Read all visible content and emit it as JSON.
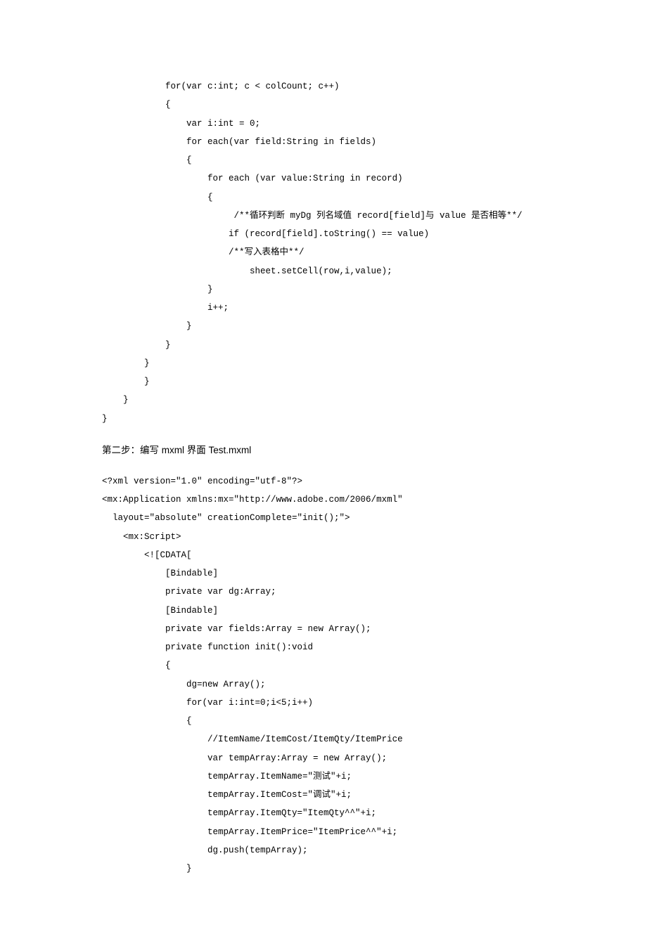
{
  "code1": "            for(var c:int; c < colCount; c++)\n            {\n                var i:int = 0;\n                for each(var field:String in fields)\n                {\n                    for each (var value:String in record)\n                    {\n                         /**循环判断 myDg 列名域值 record[field]与 value 是否相等**/\n                        if (record[field].toString() == value)\n                        /**写入表格中**/\n                            sheet.setCell(row,i,value);\n                    }\n                    i++;\n                }\n            }\n        }\n        }\n    }\n}",
  "heading": "第二步：编写 mxml 界面 Test.mxml",
  "code2": "<?xml version=\"1.0\" encoding=\"utf-8\"?>\n<mx:Application xmlns:mx=\"http://www.adobe.com/2006/mxml\"\n  layout=\"absolute\" creationComplete=\"init();\">\n    <mx:Script>\n        <![CDATA[\n            [Bindable]\n            private var dg:Array;\n            [Bindable]\n            private var fields:Array = new Array();\n            private function init():void\n            {\n                dg=new Array();\n                for(var i:int=0;i<5;i++)\n                {\n                    //ItemName/ItemCost/ItemQty/ItemPrice\n                    var tempArray:Array = new Array();\n                    tempArray.ItemName=\"测试\"+i;\n                    tempArray.ItemCost=\"调试\"+i;\n                    tempArray.ItemQty=\"ItemQty^^\"+i;\n                    tempArray.ItemPrice=\"ItemPrice^^\"+i;\n                    dg.push(tempArray);\n                }"
}
